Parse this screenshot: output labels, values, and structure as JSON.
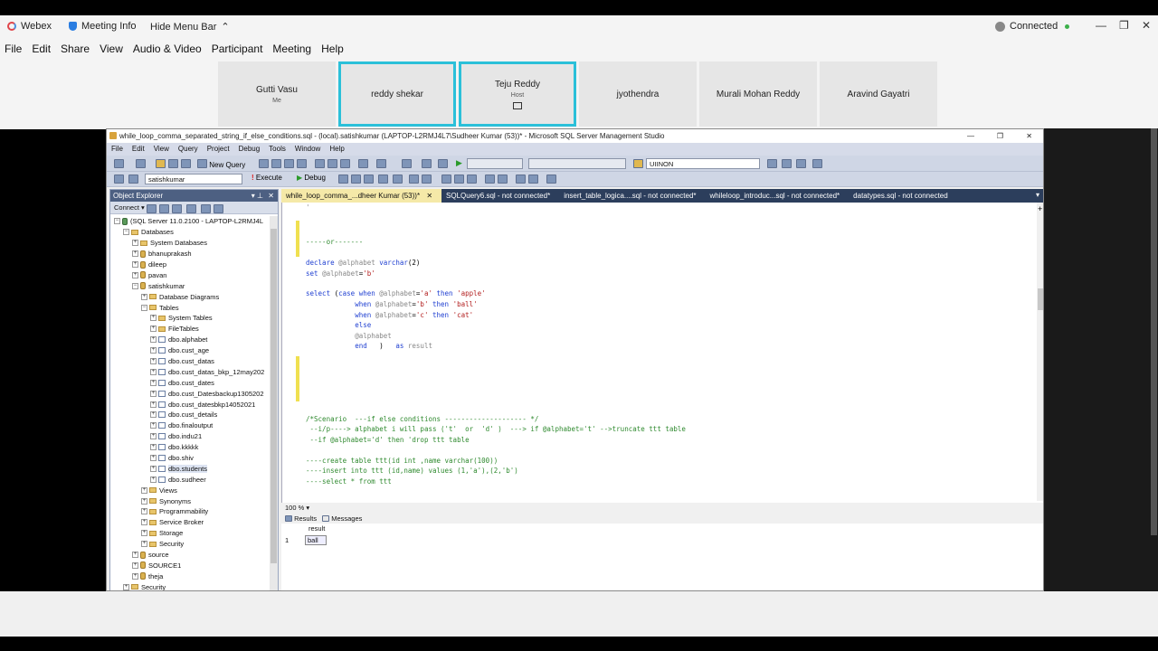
{
  "webex": {
    "app_name": "Webex",
    "meeting_info": "Meeting Info",
    "hide_menu": "Hide Menu Bar",
    "status": "Connected",
    "menu": [
      "File",
      "Edit",
      "Share",
      "View",
      "Audio & Video",
      "Participant",
      "Meeting",
      "Help"
    ],
    "participants": [
      {
        "name": "Gutti Vasu",
        "sub": "Me",
        "active": false
      },
      {
        "name": "reddy shekar",
        "sub": "",
        "active": true
      },
      {
        "name": "Teju Reddy",
        "sub": "Host",
        "active": true
      },
      {
        "name": "jyothendra",
        "sub": "",
        "active": false
      },
      {
        "name": "Murali Mohan Reddy",
        "sub": "",
        "active": false
      },
      {
        "name": "Aravind Gayatri",
        "sub": "",
        "active": false
      }
    ],
    "accent_color": "#2bc0d9"
  },
  "ssms": {
    "title": "while_loop_comma_separated_string_if_else_conditions.sql - (local).satishkumar (LAPTOP-L2RMJ4L7\\Sudheer Kumar (53))* - Microsoft SQL Server Management Studio",
    "menu": [
      "File",
      "Edit",
      "View",
      "Query",
      "Project",
      "Debug",
      "Tools",
      "Window",
      "Help"
    ],
    "toolbar": {
      "new_query": "New Query",
      "db_combo": "satishkumar",
      "execute": "Execute",
      "debug": "Debug",
      "search_combo": "UIINON"
    },
    "object_explorer": {
      "title": "Object Explorer",
      "connect": "Connect ▾",
      "server": "(SQL Server 11.0.2100 - LAPTOP-L2RMJ4L",
      "databases": "Databases",
      "system_databases": "System Databases",
      "db_list_before": [
        "bhanuprakash",
        "dileep",
        "pavan"
      ],
      "current_db": "satishkumar",
      "db_diagrams": "Database Diagrams",
      "tables": "Tables",
      "system_tables": "System Tables",
      "file_tables": "FileTables",
      "table_list": [
        "dbo.alphabet",
        "dbo.cust_age",
        "dbo.cust_datas",
        "dbo.cust_datas_bkp_12may202",
        "dbo.cust_dates",
        "dbo.cust_Datesbackup1305202",
        "dbo.cust_datesbkp14052021",
        "dbo.cust_details",
        "dbo.finaloutput",
        "dbo.indu21",
        "dbo.kkkkk",
        "dbo.shiv",
        "dbo.students",
        "dbo.sudheer"
      ],
      "folders_after": [
        "Views",
        "Synonyms",
        "Programmability",
        "Service Broker",
        "Storage",
        "Security"
      ],
      "db_list_after": [
        "source",
        "SOURCE1",
        "theja"
      ],
      "last_item": "Security"
    },
    "tabs": [
      "while_loop_comma_...dheer Kumar (53))*",
      "SQLQuery6.sql - not connected*",
      "insert_table_logica....sql - not connected*",
      "whileloop_introduc...sql - not connected*",
      "datatypes.sql - not connected"
    ],
    "zoom": "100 %",
    "results_tab": "Results",
    "messages_tab": "Messages",
    "result_header": "result",
    "result_row_num": "1",
    "result_value": "ball"
  }
}
